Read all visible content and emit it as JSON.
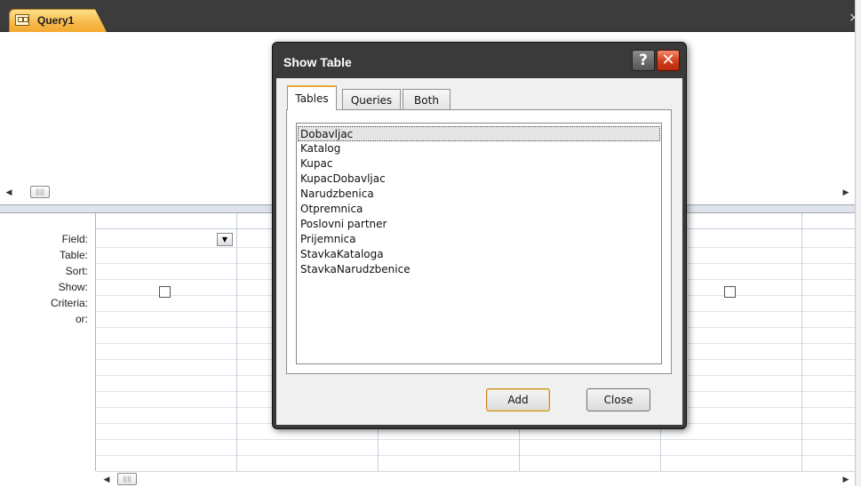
{
  "document": {
    "tab_title": "Query1",
    "close_glyph": "×"
  },
  "qbe_grid": {
    "row_labels": [
      "Field:",
      "Table:",
      "Sort:",
      "Show:",
      "Criteria:",
      "or:"
    ],
    "show_checked": [
      false,
      false
    ]
  },
  "dialog": {
    "title": "Show Table",
    "help_glyph": "?",
    "close_glyph": "✕",
    "tabs": [
      {
        "label": "Tables",
        "active": true
      },
      {
        "label": "Queries",
        "active": false
      },
      {
        "label": "Both",
        "active": false
      }
    ],
    "tables": [
      "Dobavljac",
      "Katalog",
      "Kupac",
      "KupacDobavljac",
      "Narudzbenica",
      "Otpremnica",
      "Poslovni partner",
      "Prijemnica",
      "StavkaKataloga",
      "StavkaNarudzbenice"
    ],
    "selected_table": "Dobavljac",
    "add_label": "Add",
    "close_label": "Close"
  },
  "icons": {
    "query_icon": "query-icon",
    "scroll_left": "◀",
    "scroll_right": "▶",
    "thumb_grip": "||||",
    "dropdown_arrow": "▼"
  },
  "colors": {
    "tab_accent": "#f3a92f",
    "close_button": "#d33d1b",
    "active_tab_border": "#e7a838"
  }
}
